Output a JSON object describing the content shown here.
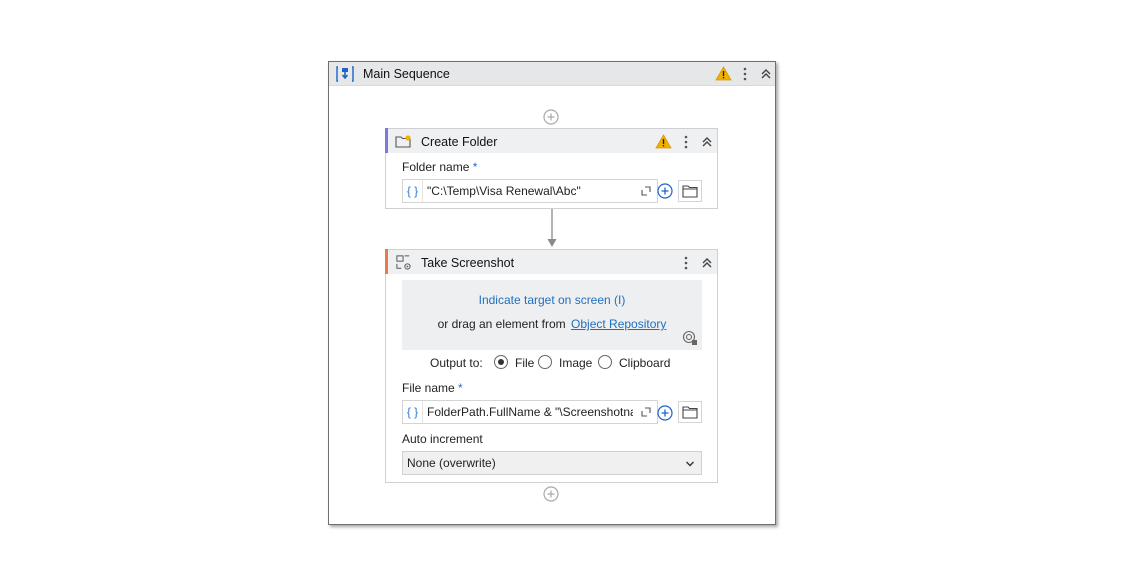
{
  "main_sequence": {
    "title": "Main Sequence"
  },
  "create_folder": {
    "title": "Create Folder",
    "folder_name_label": "Folder name",
    "required_mark": "*",
    "expression_prefix": "{ }",
    "folder_name_value": "\"C:\\Temp\\Visa Renewal\\Abc\""
  },
  "take_screenshot": {
    "title": "Take Screenshot",
    "indicate_link": "Indicate target on screen (I)",
    "drag_text": "or drag an element from",
    "object_repository_link": "Object Repository",
    "output_to_label": "Output to:",
    "output_options": [
      "File",
      "Image",
      "Clipboard"
    ],
    "output_selected": "File",
    "file_name_label": "File name",
    "required_mark": "*",
    "expression_prefix": "{ }",
    "file_name_value": "FolderPath.FullName & \"\\Screenshotname",
    "auto_increment_label": "Auto increment",
    "auto_increment_value": "None (overwrite)"
  },
  "colors": {
    "warning": "#f2b100",
    "link": "#1f6fc0",
    "create_folder_accent": "#7d7bd6",
    "take_screenshot_accent": "#e87a4b"
  },
  "icons": {
    "main": "sequence-icon",
    "create_folder": "folder-add-icon",
    "take_screenshot": "screenshot-icon"
  }
}
